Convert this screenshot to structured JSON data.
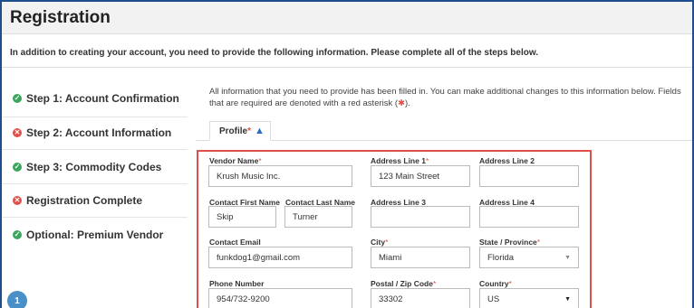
{
  "page": {
    "title": "Registration",
    "intro": "In addition to creating your account, you need to provide the following information. Please complete all of the steps below."
  },
  "sidebar": {
    "steps": [
      {
        "label": "Step 1: Account Confirmation",
        "status": "complete",
        "icon": "check-circle-icon"
      },
      {
        "label": "Step 2: Account Information",
        "status": "error",
        "icon": "x-circle-icon"
      },
      {
        "label": "Step 3: Commodity Codes",
        "status": "complete",
        "icon": "check-circle-icon"
      },
      {
        "label": "Registration Complete",
        "status": "error",
        "icon": "x-circle-icon"
      },
      {
        "label": "Optional: Premium Vendor",
        "status": "complete",
        "icon": "check-circle-icon"
      }
    ],
    "badge_count": "1"
  },
  "info": {
    "text_before": "All information that you need to provide has been filled in. You can make additional changes to this information below. Fields that are required are denoted with a red asterisk (",
    "star": "✱",
    "text_after": ")."
  },
  "tabs": {
    "profile_label": "Profile",
    "required_mark": "*",
    "warning_icon": "warning-triangle-icon"
  },
  "form": {
    "required_mark": "*",
    "vendor_name": {
      "label": "Vendor Name",
      "value": "Krush Music Inc."
    },
    "address_line_1": {
      "label": "Address Line 1",
      "value": "123 Main Street"
    },
    "address_line_2": {
      "label": "Address Line 2",
      "value": ""
    },
    "contact_first_name": {
      "label": "Contact First Name",
      "value": "Skip"
    },
    "contact_last_name": {
      "label": "Contact Last Name",
      "value": "Turner"
    },
    "address_line_3": {
      "label": "Address Line 3",
      "value": ""
    },
    "address_line_4": {
      "label": "Address Line 4",
      "value": ""
    },
    "contact_email": {
      "label": "Contact Email",
      "value": "funkdog1@gmail.com"
    },
    "city": {
      "label": "City",
      "value": "Miami"
    },
    "state": {
      "label": "State / Province",
      "value": "Florida"
    },
    "phone_number": {
      "label": "Phone Number",
      "value": "954/732-9200"
    },
    "postal_code": {
      "label": "Postal / Zip Code",
      "value": "33302"
    },
    "country": {
      "label": "Country",
      "value": "US"
    }
  },
  "colors": {
    "accent": "#1f4e8c",
    "success": "#3ba55d",
    "error": "#e0504a",
    "badge": "#4a90c8"
  }
}
